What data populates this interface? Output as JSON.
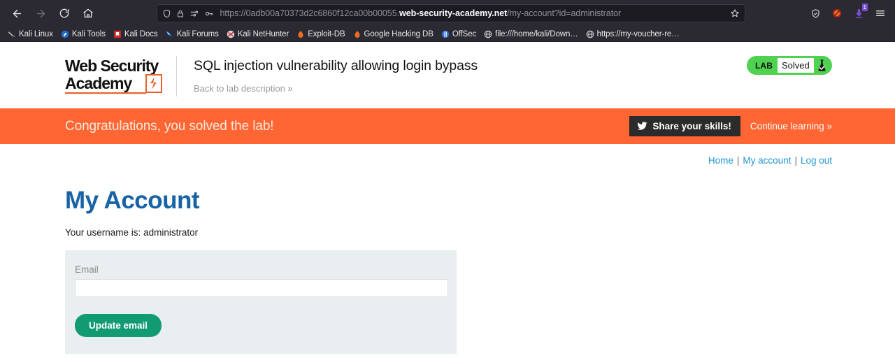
{
  "browser": {
    "nav": {
      "back": "back-arrow",
      "forward": "forward-arrow",
      "reload": "reload",
      "home": "home"
    },
    "urlbar": {
      "scheme": "https://",
      "subdomain": "0adb00a70373d2c6860f12ca00b00055.",
      "host": "web-security-academy.net",
      "path": "/my-account?id=administrator",
      "full_url": "https://0adb00a70373d2c6860f12ca00b00055.web-security-academy.net/my-account?id=administrator",
      "icons": [
        "shield-icon",
        "padlock-icon",
        "tracker-settings-icon",
        "key-icon",
        "bookmark-star-icon"
      ]
    },
    "toolbar_right": [
      {
        "name": "privacy-shield-icon"
      },
      {
        "name": "ublock-origin-icon"
      },
      {
        "name": "downloads-icon",
        "badge": "1"
      },
      {
        "name": "app-menu-icon"
      }
    ],
    "bookmarks": [
      {
        "label": "Kali Linux",
        "icon": "kali-dragon-icon"
      },
      {
        "label": "Kali Tools",
        "icon": "kali-tools-icon"
      },
      {
        "label": "Kali Docs",
        "icon": "kali-docs-icon"
      },
      {
        "label": "Kali Forums",
        "icon": "kali-forums-icon"
      },
      {
        "label": "Kali NetHunter",
        "icon": "kali-nethunter-icon"
      },
      {
        "label": "Exploit-DB",
        "icon": "exploit-db-icon"
      },
      {
        "label": "Google Hacking DB",
        "icon": "google-hacking-db-icon"
      },
      {
        "label": "OffSec",
        "icon": "offsec-icon"
      },
      {
        "label": "file:///home/kali/Down…",
        "icon": "globe-icon"
      },
      {
        "label": "https://my-voucher-re…",
        "icon": "globe-icon"
      }
    ]
  },
  "lab_header": {
    "logo_line1": "Web Security",
    "logo_line2": "Academy",
    "title": "SQL injection vulnerability allowing login bypass",
    "back_link": "Back to lab description",
    "back_chevron": "»",
    "status_tag": "LAB",
    "status_value": "Solved",
    "status_icon": "flask-check-icon"
  },
  "banner": {
    "message": "Congratulations, you solved the lab!",
    "share_label": "Share your skills!",
    "share_icon": "twitter-bird-icon",
    "continue_label": "Continue learning",
    "continue_chevron": "»"
  },
  "account_nav": {
    "home": "Home",
    "my_account": "My account",
    "log_out": "Log out",
    "separator": "|"
  },
  "main": {
    "page_title": "My Account",
    "username_line": "Your username is: administrator",
    "email_label": "Email",
    "email_value": "",
    "email_placeholder": "",
    "update_button": "Update email"
  },
  "colors": {
    "banner_orange": "#ff6633",
    "lab_green": "#4fd24f",
    "button_teal": "#129b72",
    "link_blue": "#2196d6",
    "title_blue": "#1763a6",
    "form_bg": "#e9eef1",
    "chrome_bg": "#2b2a33"
  }
}
